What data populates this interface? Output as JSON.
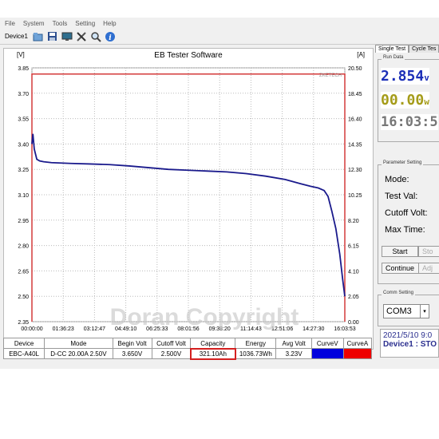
{
  "menu": [
    "File",
    "System",
    "Tools",
    "Setting",
    "Help"
  ],
  "toolbar": {
    "device_label": "Device1"
  },
  "chart": {
    "title": "EB Tester Software",
    "left_unit": "[V]",
    "right_unit": "[A]",
    "watermark_brand": "ZKETECH",
    "watermark_text": "Doran Copyright"
  },
  "chart_data": {
    "type": "line",
    "title": "EB Tester Software",
    "xlabel": "",
    "ylabel": "[V]",
    "y2label": "[A]",
    "x_ticks": [
      "00:00:00",
      "01:36:23",
      "03:12:47",
      "04:49:10",
      "06:25:33",
      "08:01:56",
      "09:38:20",
      "11:14:43",
      "12:51:06",
      "14:27:30",
      "16:03:53"
    ],
    "y_ticks": [
      "2.35",
      "2.50",
      "2.65",
      "2.80",
      "2.95",
      "3.10",
      "3.25",
      "3.40",
      "3.55",
      "3.70",
      "3.85"
    ],
    "y2_ticks": [
      "0.00",
      "2.05",
      "4.10",
      "6.15",
      "8.20",
      "10.25",
      "12.30",
      "14.35",
      "16.40",
      "18.45",
      "20.50"
    ],
    "ylim": [
      2.35,
      3.85
    ],
    "y2lim": [
      0,
      20.5
    ],
    "grid": true,
    "series": [
      {
        "color": "#1a1a8c",
        "x_hours": [
          0,
          0.05,
          0.12,
          0.25,
          0.4,
          0.6,
          1.0,
          2.0,
          3.0,
          4.0,
          5.0,
          6.0,
          7.0,
          8.0,
          9.0,
          10.0,
          11.0,
          12.0,
          13.0,
          13.8,
          14.3,
          14.7,
          15.0,
          15.2,
          15.4,
          15.6,
          15.8,
          15.95,
          16.06
        ],
        "values": [
          3.4,
          3.46,
          3.37,
          3.31,
          3.3,
          3.295,
          3.29,
          3.285,
          3.282,
          3.278,
          3.27,
          3.26,
          3.25,
          3.245,
          3.24,
          3.235,
          3.225,
          3.21,
          3.19,
          3.165,
          3.15,
          3.14,
          3.125,
          3.09,
          3.0,
          2.9,
          2.75,
          2.6,
          2.5
        ]
      },
      {
        "color": "#d43a3a",
        "x_hours": [
          0,
          16.06
        ],
        "values": [
          20.0,
          20.0
        ]
      }
    ]
  },
  "table": {
    "headers": [
      "Device",
      "Mode",
      "Begin Volt",
      "Cutoff Volt",
      "Capacity",
      "Energy",
      "Avg Volt",
      "CurveV",
      "CurveA"
    ],
    "row": [
      "EBC-A40L",
      "D-CC 20.00A 2.50V",
      "3.650V",
      "2.500V",
      "321.10Ah",
      "1036.73Wh",
      "3.23V",
      "",
      ""
    ],
    "curve_colors": [
      "#0000dd",
      "#ee0000"
    ]
  },
  "right": {
    "tab_single": "Single Test",
    "tab_cycle": "Cycle Tes",
    "run_data_label": "Run Data",
    "voltage": "2.854",
    "voltage_unit": "v",
    "power": "00.00",
    "power_unit": "w",
    "time": "16:03:5",
    "param_label": "Parameter Setting",
    "mode": "Mode:",
    "test_val": "Test Val:",
    "cutoff": "Cutoff Volt:",
    "max_time": "Max Time:",
    "start": "Start",
    "stop": "Sto",
    "continue": "Continue",
    "adjust": "Adj",
    "comm_label": "Comm Setting",
    "com_port": "COM3",
    "status_date": "2021/5/10 9:0",
    "status_device": "Device1 : STO"
  }
}
